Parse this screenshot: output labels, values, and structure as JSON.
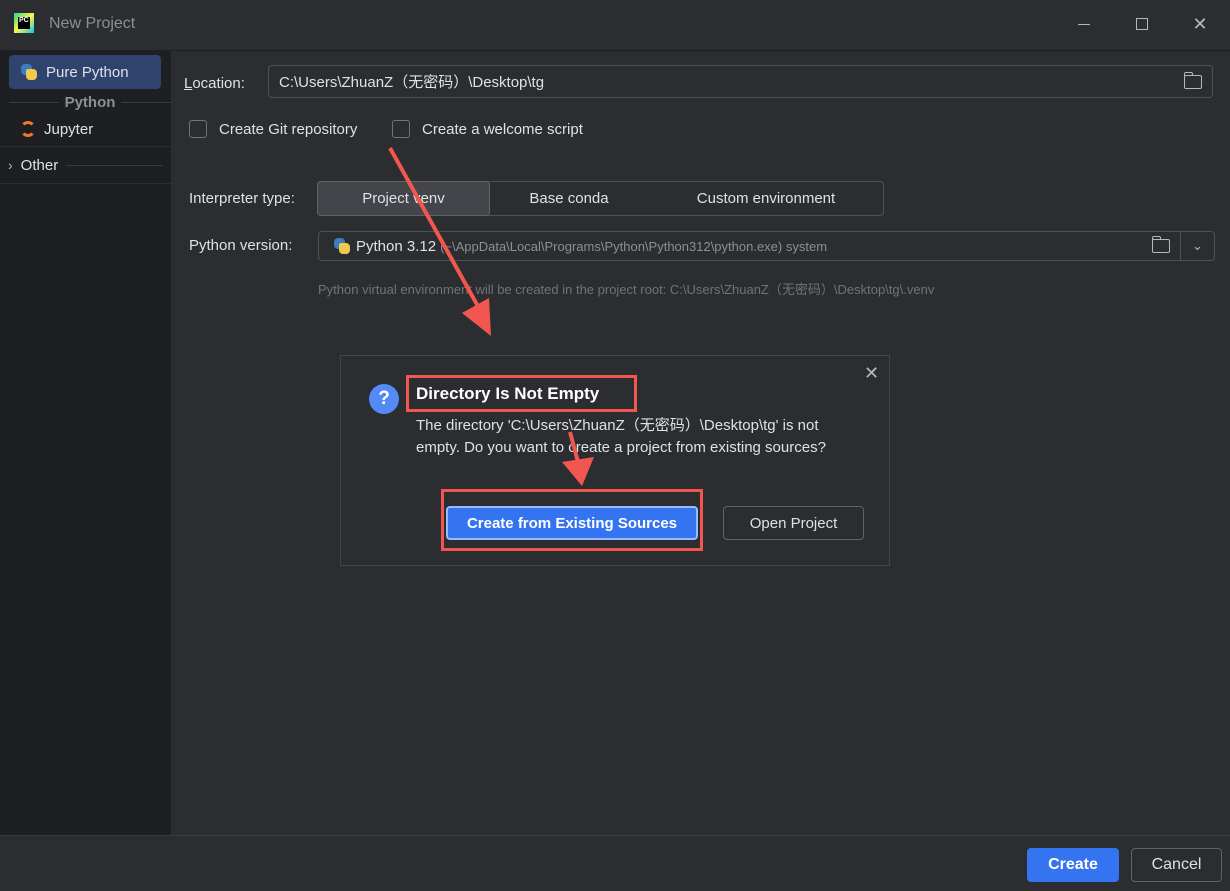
{
  "window": {
    "title": "New Project",
    "app_logo_text": "PC"
  },
  "sidebar": {
    "items": [
      {
        "label": "Pure Python",
        "selected": true,
        "icon": "python-icon"
      }
    ],
    "section_header": "Python",
    "python_items": [
      {
        "label": "Jupyter",
        "icon": "jupyter-icon"
      }
    ],
    "other": {
      "label": "Other",
      "icon": "chevron-right-icon"
    }
  },
  "form": {
    "location_label_first": "L",
    "location_label_rest": "ocation:",
    "location_value": "C:\\Users\\ZhuanZ（无密码）\\Desktop\\tg",
    "create_git_label": "Create Git repository",
    "create_welcome_label": "Create a welcome script",
    "interpreter_label": "Interpreter type:",
    "interpreter_options": [
      "Project venv",
      "Base conda",
      "Custom environment"
    ],
    "interpreter_selected": "Project venv",
    "python_version_label": "Python version:",
    "python_version_main": "Python 3.12",
    "python_version_path": "(~\\AppData\\Local\\Programs\\Python\\Python312\\python.exe) system",
    "hint": "Python virtual environment will be created in the project root: C:\\Users\\ZhuanZ（无密码）\\Desktop\\tg\\.venv"
  },
  "dialog": {
    "title": "Directory Is Not Empty",
    "icon": "question-icon",
    "message": "The directory 'C:\\Users\\ZhuanZ（无密码）\\Desktop\\tg' is not empty. Do you want to create a project from existing sources?",
    "primary_button": "Create from Existing Sources",
    "secondary_button": "Open Project"
  },
  "footer": {
    "create_label": "Create",
    "cancel_label": "Cancel"
  },
  "colors": {
    "accent": "#3574f0",
    "annotation": "#f2574f",
    "background": "#2b2d30",
    "sidebar": "#1e1f22"
  }
}
